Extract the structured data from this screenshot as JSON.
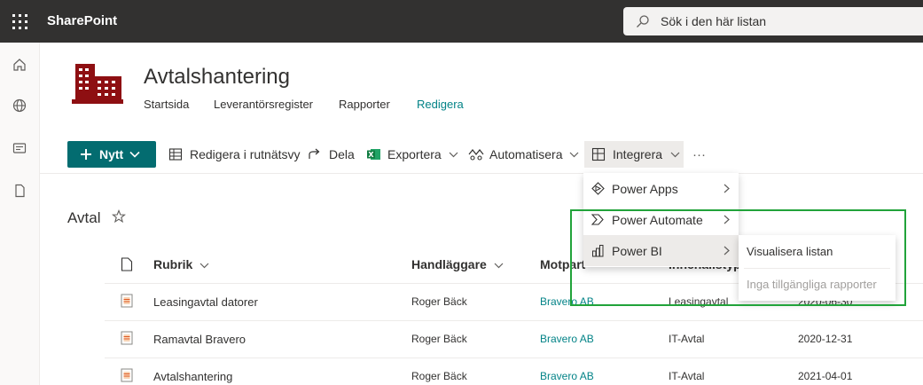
{
  "suite": {
    "app_name": "SharePoint",
    "search_placeholder": "Sök i den här listan"
  },
  "site": {
    "title": "Avtalshantering",
    "nav": [
      "Startsida",
      "Leverantörsregister",
      "Rapporter",
      "Redigera"
    ]
  },
  "commands": {
    "new": "Nytt",
    "edit_grid": "Redigera i rutnätsvy",
    "share": "Dela",
    "export": "Exportera",
    "automate": "Automatisera",
    "integrate": "Integrera",
    "more": "···"
  },
  "integrate_menu": {
    "items": [
      "Power Apps",
      "Power Automate",
      "Power BI"
    ]
  },
  "powerbi_submenu": {
    "visualize": "Visualisera listan",
    "no_reports": "Inga tillgängliga rapporter"
  },
  "list": {
    "title": "Avtal",
    "columns": [
      "Rubrik",
      "Handläggare",
      "Motpart",
      "Innehållstyp"
    ],
    "rows": [
      {
        "title": "Leasingavtal datorer",
        "handler": "Roger Bäck",
        "counterpart": "Bravero AB",
        "type": "Leasingavtal",
        "date": "2020-06-30"
      },
      {
        "title": "Ramavtal Bravero",
        "handler": "Roger Bäck",
        "counterpart": "Bravero AB",
        "type": "IT-Avtal",
        "date": "2020-12-31"
      },
      {
        "title": "Avtalshantering",
        "handler": "Roger Bäck",
        "counterpart": "Bravero AB",
        "type": "IT-Avtal",
        "date": "2021-04-01"
      }
    ]
  },
  "colors": {
    "suite_bar": "#323130",
    "accent": "#036c70",
    "link": "#038387",
    "highlight_box": "#21a33a",
    "logo": "#8e0f12"
  }
}
